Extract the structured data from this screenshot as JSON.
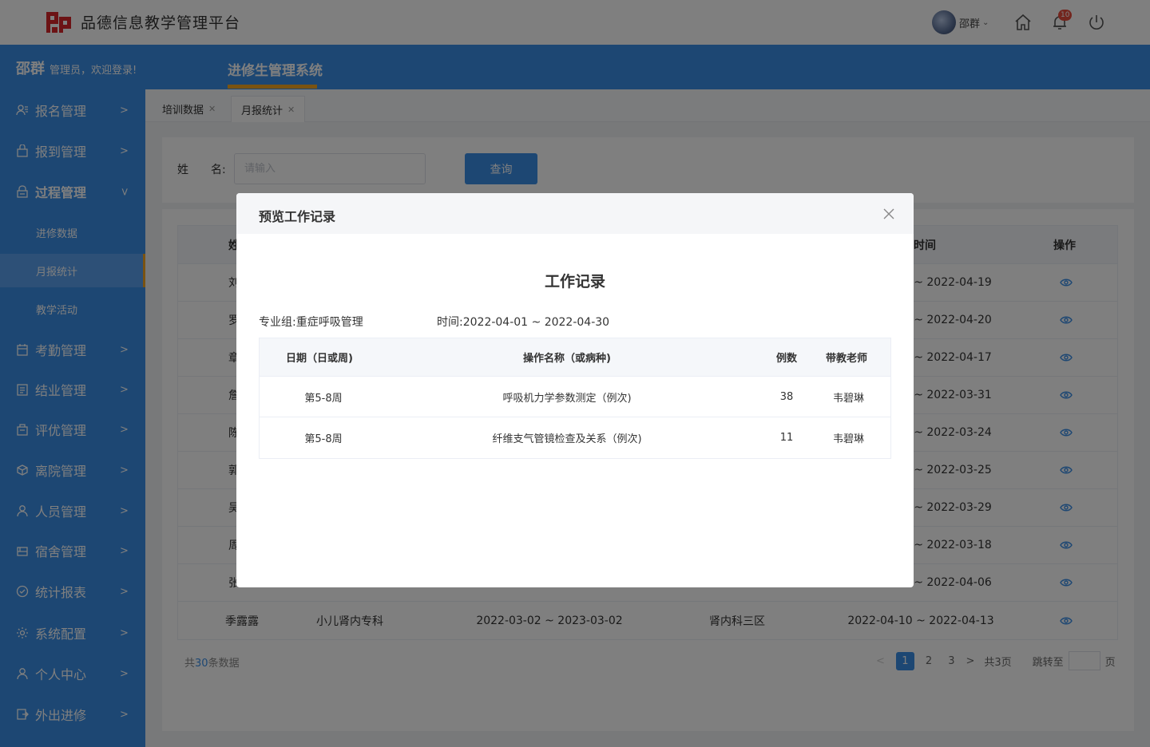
{
  "app": {
    "title": "品德信息教学管理平台"
  },
  "topbar": {
    "user_name": "邵群",
    "notification_count": "10"
  },
  "header": {
    "welcome_name": "邵群",
    "welcome_text": "管理员，欢迎登录!",
    "system_title": "进修生管理系统"
  },
  "sidebar": {
    "items": [
      {
        "label": "报名管理",
        "icon": "user-list-icon"
      },
      {
        "label": "报到管理",
        "icon": "bag-icon"
      },
      {
        "label": "过程管理",
        "icon": "lock-icon",
        "expanded": true
      },
      {
        "label": "考勤管理",
        "icon": "calendar-icon"
      },
      {
        "label": "结业管理",
        "icon": "document-icon"
      },
      {
        "label": "评优管理",
        "icon": "building-icon"
      },
      {
        "label": "离院管理",
        "icon": "box-icon"
      },
      {
        "label": "人员管理",
        "icon": "person-icon"
      },
      {
        "label": "宿舍管理",
        "icon": "bed-icon"
      },
      {
        "label": "统计报表",
        "icon": "check-circle-icon"
      },
      {
        "label": "系统配置",
        "icon": "gear-icon"
      },
      {
        "label": "个人中心",
        "icon": "person-icon"
      },
      {
        "label": "外出进修",
        "icon": "exit-icon"
      }
    ],
    "sub_items": [
      {
        "label": "进修数据"
      },
      {
        "label": "月报统计",
        "active": true
      },
      {
        "label": "教学活动"
      }
    ]
  },
  "tabs": [
    {
      "label": "培训数据"
    },
    {
      "label": "月报统计",
      "active": true
    }
  ],
  "search": {
    "label": "姓　　名:",
    "placeholder": "请输入",
    "button": "查询"
  },
  "table": {
    "header_name": "姓",
    "header_time": "时间",
    "header_action": "操作",
    "rows": [
      {
        "name": "刘",
        "time": "~ 2022-04-19"
      },
      {
        "name": "罗",
        "time": "~ 2022-04-20"
      },
      {
        "name": "章",
        "time": "~ 2022-04-17"
      },
      {
        "name": "詹",
        "time": "~ 2022-03-31"
      },
      {
        "name": "陈",
        "time": "~ 2022-03-24"
      },
      {
        "name": "郭",
        "time": "~ 2022-03-25"
      },
      {
        "name": "吴",
        "time": "~ 2022-03-29"
      },
      {
        "name": "周",
        "time": "~ 2022-03-18"
      },
      {
        "name": "张",
        "time": "~ 2022-04-06"
      }
    ],
    "last_row": {
      "name": "季露露",
      "dept": "小儿肾内专科",
      "period": "2022-03-02 ~ 2023-03-02",
      "ward": "肾内科三区",
      "time": "2022-04-10 ~ 2022-04-13"
    }
  },
  "pagination": {
    "total_prefix": "共",
    "total_count": "30",
    "total_suffix": "条数据",
    "pages": [
      "1",
      "2",
      "3"
    ],
    "current": "1",
    "total_pages": "共3页",
    "jump_label": "跳转至",
    "page_unit": "页"
  },
  "dialog": {
    "title": "预览工作记录",
    "doc_title": "工作记录",
    "group_label": "专业组:",
    "group_value": "重症呼吸管理",
    "time_label": "时间:",
    "time_value": "2022-04-01 ~ 2022-04-30",
    "columns": [
      "日期（日或周)",
      "操作名称（或病种)",
      "例数",
      "带教老师"
    ],
    "rows": [
      {
        "date": "第5-8周",
        "operation": "呼吸机力学参数测定（例次)",
        "count": "38",
        "teacher": "韦碧琳"
      },
      {
        "date": "第5-8周",
        "operation": "纤维支气管镜检查及关系（例次)",
        "count": "11",
        "teacher": "韦碧琳"
      }
    ]
  },
  "colors": {
    "primary": "#3a8ee6",
    "accent": "#f5a623",
    "logo": "#d9262b"
  }
}
